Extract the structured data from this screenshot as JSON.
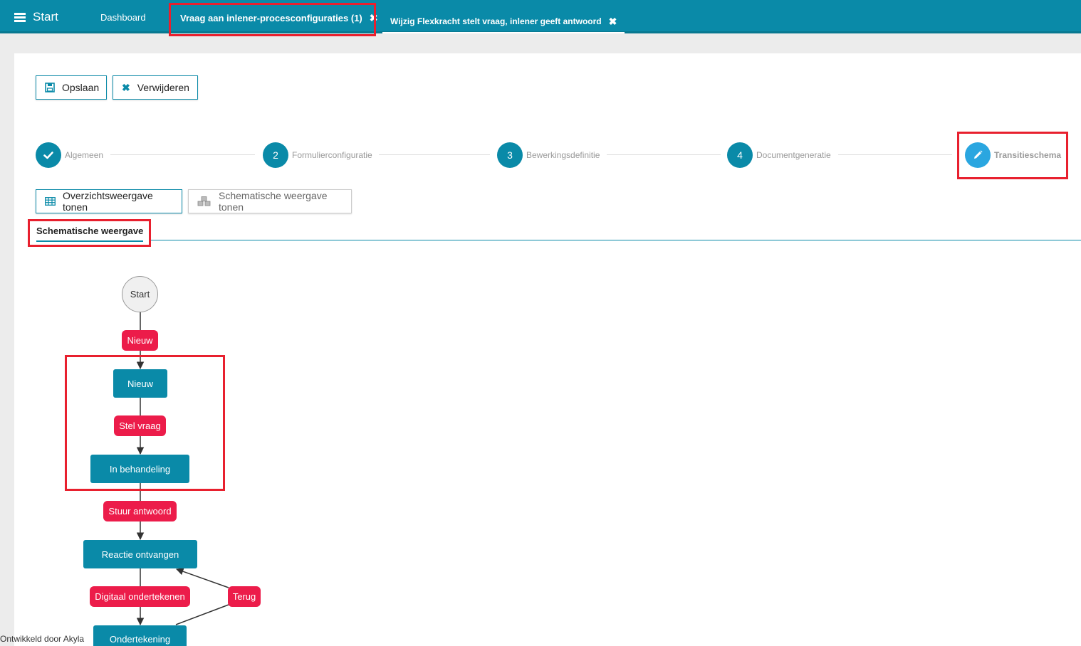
{
  "nav": {
    "menu_label": "Start",
    "dashboard_label": "Dashboard",
    "tabs": [
      {
        "label": "Vraag aan inlener-procesconfiguraties (1)",
        "close": "✖"
      },
      {
        "label": "Wijzig Flexkracht stelt vraag, inlener geeft antwoord",
        "close": "✖"
      }
    ]
  },
  "toolbar": {
    "save_label": "Opslaan",
    "delete_label": "Verwijderen"
  },
  "stepper": {
    "steps": [
      {
        "number": "",
        "label": "Algemeen",
        "state": "done"
      },
      {
        "number": "2",
        "label": "Formulierconfiguratie",
        "state": "todo"
      },
      {
        "number": "3",
        "label": "Bewerkingsdefinitie",
        "state": "todo"
      },
      {
        "number": "4",
        "label": "Documentgeneratie",
        "state": "todo"
      },
      {
        "number": "",
        "label": "Transitieschema",
        "state": "current"
      }
    ]
  },
  "view_buttons": {
    "overview_label": "Overzichtsweergave tonen",
    "schematic_label": "Schematische weergave tonen"
  },
  "subtab": {
    "label": "Schematische weergave"
  },
  "diagram": {
    "start_label": "Start",
    "states": [
      "Nieuw",
      "In behandeling",
      "Reactie ontvangen",
      "Ondertekening"
    ],
    "transitions": [
      "Nieuw",
      "Stel vraag",
      "Stuur antwoord",
      "Digitaal ondertekenen",
      "Terug"
    ]
  },
  "colors": {
    "brand": "#0a8aa8",
    "transition": "#ec1c4a",
    "highlight": "#e8202e",
    "current_step": "#2aa6e0"
  },
  "footer": {
    "text": "Ontwikkeld door Akyla"
  }
}
